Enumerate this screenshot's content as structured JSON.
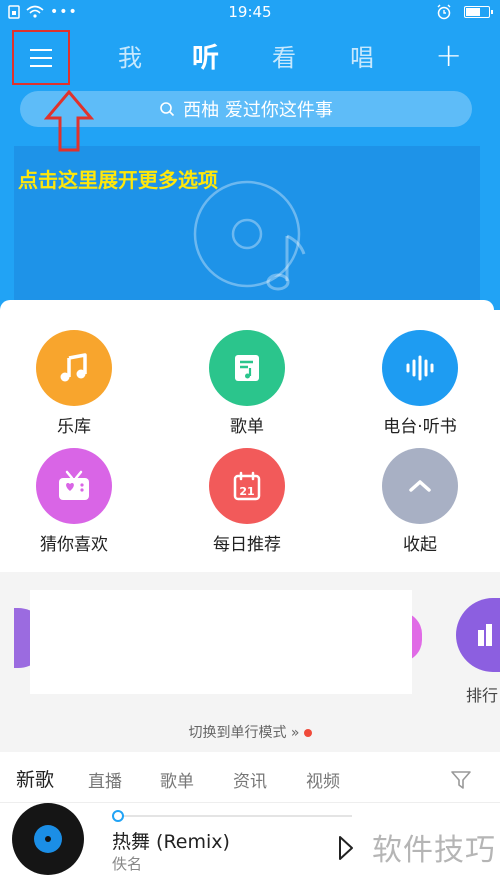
{
  "status_bar": {
    "time": "19:45"
  },
  "nav": {
    "tabs": [
      {
        "label": "我"
      },
      {
        "label": "听"
      },
      {
        "label": "看"
      },
      {
        "label": "唱"
      }
    ],
    "plus_label": "+"
  },
  "search": {
    "text": "西柚 爱过你这件事"
  },
  "banner": {
    "hint": "点击这里展开更多选项"
  },
  "grid": [
    {
      "label": "乐库",
      "color": "#f8a52d",
      "icon": "music-note-icon"
    },
    {
      "label": "歌单",
      "color": "#2bc58c",
      "icon": "playlist-icon"
    },
    {
      "label": "电台·听书",
      "color": "#1e9cf2",
      "icon": "soundwave-icon"
    },
    {
      "label": "猜你喜欢",
      "color": "#d965e6",
      "icon": "radio-heart-icon"
    },
    {
      "label": "每日推荐",
      "color": "#f25a5a",
      "icon": "calendar-icon",
      "day": "21"
    },
    {
      "label": "收起",
      "color": "#a8b0c4",
      "icon": "chevron-up-icon"
    }
  ],
  "switch_mode": {
    "label": "切换到单行模式 »"
  },
  "row_partial_labels": [
    "排行"
  ],
  "content_tabs": [
    {
      "label": "新歌"
    },
    {
      "label": "直播"
    },
    {
      "label": "歌单"
    },
    {
      "label": "资讯"
    },
    {
      "label": "视频"
    }
  ],
  "player": {
    "song": "热舞 (Remix)",
    "artist": "佚名",
    "progress": 0.0
  },
  "watermark": "软件技巧",
  "colors": {
    "brand_blue": "#21a3f5",
    "highlight_red": "#e0322c",
    "hint_yellow": "#ffe70a"
  }
}
